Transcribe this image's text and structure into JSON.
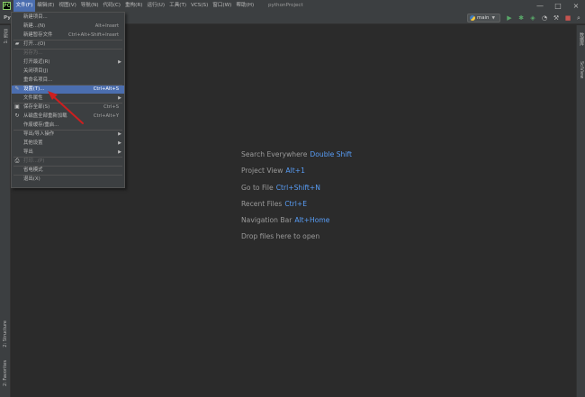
{
  "menubar": {
    "app_icon": "PC",
    "items": [
      "文件(F)",
      "编辑(E)",
      "视图(V)",
      "导航(N)",
      "代码(C)",
      "重构(R)",
      "运行(U)",
      "工具(T)",
      "VCS(S)",
      "窗口(W)",
      "帮助(H)"
    ],
    "project_title": "pythonProject",
    "window_controls": [
      "—",
      "□",
      "×"
    ]
  },
  "toolbar": {
    "project_tag": "Py",
    "run_config": "main",
    "icons": [
      "run-icon",
      "debug-icon",
      "coverage-icon",
      "profile-icon",
      "build-icon",
      "stop-icon",
      "search-icon"
    ]
  },
  "sidebars": {
    "left_tabs": [
      "1: 项目",
      "2: Structure",
      "2: Favorites"
    ],
    "right_tabs": [
      "数据库",
      "SciView"
    ]
  },
  "welcome": {
    "hints": [
      {
        "label": "Search Everywhere",
        "key": "Double Shift"
      },
      {
        "label": "Project View",
        "key": "Alt+1"
      },
      {
        "label": "Go to File",
        "key": "Ctrl+Shift+N"
      },
      {
        "label": "Recent Files",
        "key": "Ctrl+E"
      },
      {
        "label": "Navigation Bar",
        "key": "Alt+Home"
      }
    ],
    "drop_text": "Drop files here to open"
  },
  "file_menu": {
    "items": [
      {
        "label": "新建项目...",
        "shortcut": "",
        "submenu": false,
        "icon": "",
        "disabled": false,
        "selected": false
      },
      {
        "label": "新建...(N)",
        "shortcut": "Alt+Insert",
        "submenu": false,
        "icon": "",
        "disabled": false,
        "selected": false
      },
      {
        "label": "新建暂存文件",
        "shortcut": "Ctrl+Alt+Shift+Insert",
        "submenu": false,
        "icon": "",
        "disabled": false,
        "selected": false
      },
      {
        "label": "打开...(O)",
        "shortcut": "",
        "submenu": false,
        "icon": "folder-icon",
        "disabled": false,
        "selected": false
      },
      {
        "label": "另存为...",
        "shortcut": "",
        "submenu": false,
        "icon": "",
        "disabled": true,
        "selected": false
      },
      {
        "label": "打开最近(R)",
        "shortcut": "",
        "submenu": true,
        "icon": "",
        "disabled": false,
        "selected": false
      },
      {
        "label": "关闭项目(J)",
        "shortcut": "",
        "submenu": false,
        "icon": "",
        "disabled": false,
        "selected": false
      },
      {
        "label": "重命名项目...",
        "shortcut": "",
        "submenu": false,
        "icon": "",
        "disabled": false,
        "selected": false
      },
      {
        "label": "设置(T)...",
        "shortcut": "Ctrl+Alt+S",
        "submenu": false,
        "icon": "wrench-icon",
        "disabled": false,
        "selected": true
      },
      {
        "label": "文件属性",
        "shortcut": "",
        "submenu": true,
        "icon": "",
        "disabled": false,
        "selected": false
      },
      {
        "label": "保存全部(S)",
        "shortcut": "Ctrl+S",
        "submenu": false,
        "icon": "save-icon",
        "disabled": false,
        "selected": false
      },
      {
        "label": "从磁盘全部重新加载",
        "shortcut": "Ctrl+Alt+Y",
        "submenu": false,
        "icon": "reload-icon",
        "disabled": false,
        "selected": false
      },
      {
        "label": "作废缓存/重启...",
        "shortcut": "",
        "submenu": false,
        "icon": "",
        "disabled": false,
        "selected": false
      },
      {
        "label": "导出/导入操作",
        "shortcut": "",
        "submenu": true,
        "icon": "",
        "disabled": false,
        "selected": false
      },
      {
        "label": "其他设置",
        "shortcut": "",
        "submenu": true,
        "icon": "",
        "disabled": false,
        "selected": false
      },
      {
        "label": "导出",
        "shortcut": "",
        "submenu": true,
        "icon": "",
        "disabled": false,
        "selected": false
      },
      {
        "label": "打印...(P)",
        "shortcut": "",
        "submenu": false,
        "icon": "print-icon",
        "disabled": true,
        "selected": false
      },
      {
        "label": "省电模式",
        "shortcut": "",
        "submenu": false,
        "icon": "",
        "disabled": false,
        "selected": false
      },
      {
        "label": "退出(X)",
        "shortcut": "",
        "submenu": false,
        "icon": "",
        "disabled": false,
        "selected": false
      }
    ]
  },
  "colors": {
    "accent": "#4b6eaf",
    "shortcut_link": "#589df6",
    "annotation_arrow": "#cc1f1f",
    "run_green": "#59a869"
  }
}
